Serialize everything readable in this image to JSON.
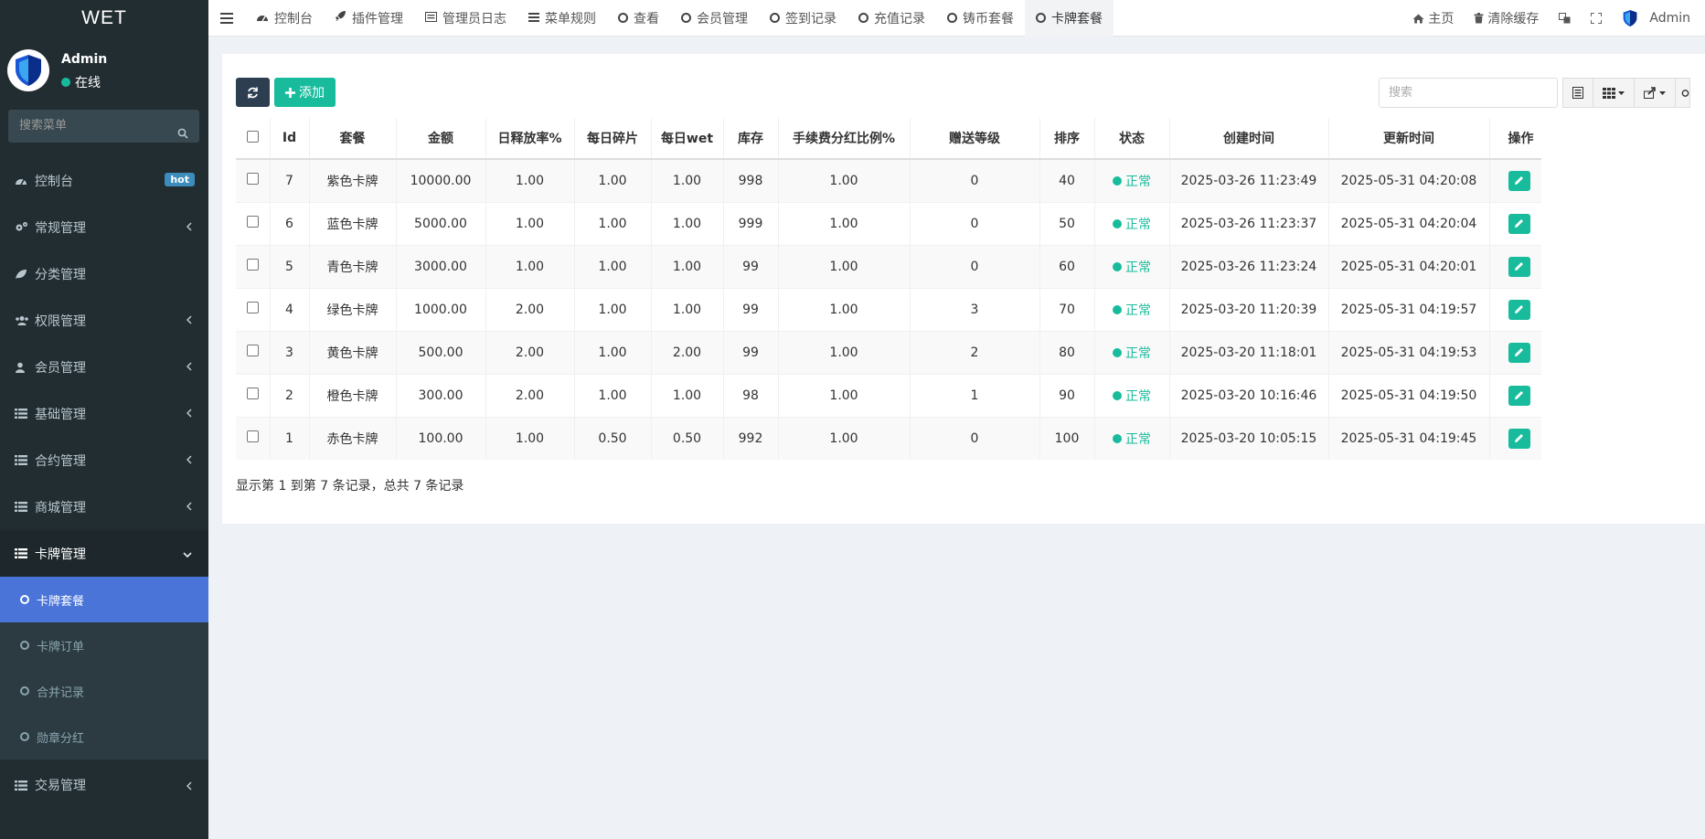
{
  "brand": "WET",
  "user": {
    "name": "Admin",
    "status": "在线"
  },
  "sidebar": {
    "search_placeholder": "搜索菜单",
    "items": [
      {
        "label": "控制台",
        "icon": "dashboard-icon",
        "badge": "hot"
      },
      {
        "label": "常规管理",
        "icon": "cogs-icon"
      },
      {
        "label": "分类管理",
        "icon": "leaf-icon"
      },
      {
        "label": "权限管理",
        "icon": "group-icon"
      },
      {
        "label": "会员管理",
        "icon": "user-icon"
      },
      {
        "label": "基础管理",
        "icon": "list-icon"
      },
      {
        "label": "合约管理",
        "icon": "list-icon"
      },
      {
        "label": "商城管理",
        "icon": "list-icon"
      },
      {
        "label": "卡牌管理",
        "icon": "list-icon"
      },
      {
        "label": "交易管理",
        "icon": "list-icon"
      }
    ],
    "submenu": [
      {
        "label": "卡牌套餐",
        "active": true
      },
      {
        "label": "卡牌订单"
      },
      {
        "label": "合并记录"
      },
      {
        "label": "勋章分红"
      }
    ]
  },
  "topbar": {
    "tabs": [
      {
        "label": "控制台",
        "icon": "dashboard-icon"
      },
      {
        "label": "插件管理",
        "icon": "rocket-icon"
      },
      {
        "label": "管理员日志",
        "icon": "list-alt-icon"
      },
      {
        "label": "菜单规则",
        "icon": "bars-icon"
      },
      {
        "label": "查看",
        "icon": "circle-o-icon"
      },
      {
        "label": "会员管理",
        "icon": "circle-o-icon"
      },
      {
        "label": "签到记录",
        "icon": "circle-o-icon"
      },
      {
        "label": "充值记录",
        "icon": "circle-o-icon"
      },
      {
        "label": "铸币套餐",
        "icon": "circle-o-icon"
      },
      {
        "label": "卡牌套餐",
        "icon": "circle-o-icon",
        "active": true
      }
    ],
    "home": "主页",
    "clear_cache": "清除缓存",
    "admin": "Admin"
  },
  "toolbar": {
    "add_label": "添加",
    "search_placeholder": "搜索"
  },
  "table": {
    "columns": [
      "Id",
      "套餐",
      "金额",
      "日释放率%",
      "每日碎片",
      "每日wet",
      "库存",
      "手续费分红比例%",
      "赠送等级",
      "排序",
      "状态",
      "创建时间",
      "更新时间",
      "操作"
    ],
    "rows": [
      [
        "7",
        "紫色卡牌",
        "10000.00",
        "1.00",
        "1.00",
        "1.00",
        "998",
        "1.00",
        "0",
        "40",
        "正常",
        "2025-03-26 11:23:49",
        "2025-05-31 04:20:08"
      ],
      [
        "6",
        "蓝色卡牌",
        "5000.00",
        "1.00",
        "1.00",
        "1.00",
        "999",
        "1.00",
        "0",
        "50",
        "正常",
        "2025-03-26 11:23:37",
        "2025-05-31 04:20:04"
      ],
      [
        "5",
        "青色卡牌",
        "3000.00",
        "1.00",
        "1.00",
        "1.00",
        "99",
        "1.00",
        "0",
        "60",
        "正常",
        "2025-03-26 11:23:24",
        "2025-05-31 04:20:01"
      ],
      [
        "4",
        "绿色卡牌",
        "1000.00",
        "2.00",
        "1.00",
        "1.00",
        "99",
        "1.00",
        "3",
        "70",
        "正常",
        "2025-03-20 11:20:39",
        "2025-05-31 04:19:57"
      ],
      [
        "3",
        "黄色卡牌",
        "500.00",
        "2.00",
        "1.00",
        "2.00",
        "99",
        "1.00",
        "2",
        "80",
        "正常",
        "2025-03-20 11:18:01",
        "2025-05-31 04:19:53"
      ],
      [
        "2",
        "橙色卡牌",
        "300.00",
        "2.00",
        "1.00",
        "1.00",
        "98",
        "1.00",
        "1",
        "90",
        "正常",
        "2025-03-20 10:16:46",
        "2025-05-31 04:19:50"
      ],
      [
        "1",
        "赤色卡牌",
        "100.00",
        "1.00",
        "0.50",
        "0.50",
        "992",
        "1.00",
        "0",
        "100",
        "正常",
        "2025-03-20 10:05:15",
        "2025-05-31 04:19:45"
      ]
    ]
  },
  "pagination_info": "显示第 1 到第 7 条记录，总共 7 条记录",
  "colors": {
    "accent": "#18bc9c",
    "sidebar": "#222d32",
    "active_sub": "#4a74d8",
    "dark_btn": "#2c3e50"
  }
}
